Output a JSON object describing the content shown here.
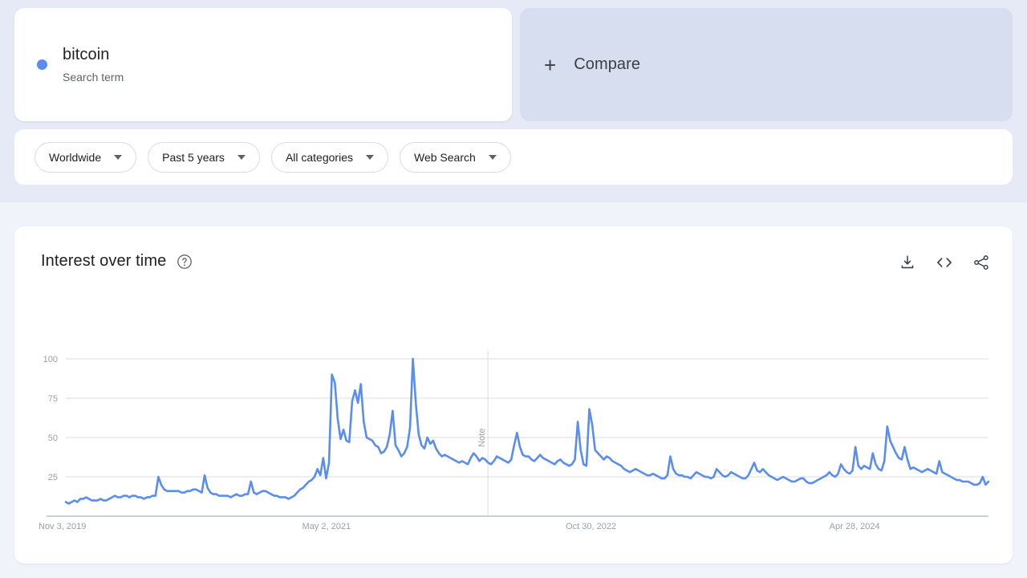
{
  "colors": {
    "series_line": "#5a8df0",
    "page_bg_top": "#e6eaf6",
    "page_bg": "#f0f3fa",
    "card_bg": "#ffffff",
    "compare_bg": "#d6deef",
    "grid": "#dadce0",
    "axis_text": "#9aa0a6",
    "text_primary": "#202124",
    "text_secondary": "#5f6368"
  },
  "search_term": {
    "label": "bitcoin",
    "type_label": "Search term",
    "dot_icon": "series-dot-icon"
  },
  "compare": {
    "label": "Compare",
    "plus_icon": "plus-icon"
  },
  "filters": [
    {
      "label": "Worldwide",
      "icon": "chevron-down-icon"
    },
    {
      "label": "Past 5 years",
      "icon": "chevron-down-icon"
    },
    {
      "label": "All categories",
      "icon": "chevron-down-icon"
    },
    {
      "label": "Web Search",
      "icon": "chevron-down-icon"
    }
  ],
  "chart_panel": {
    "title": "Interest over time",
    "help_icon": "help-circle-icon",
    "actions": [
      {
        "name": "download-icon",
        "label": "Download"
      },
      {
        "name": "embed-code-icon",
        "label": "Embed"
      },
      {
        "name": "share-icon",
        "label": "Share"
      }
    ]
  },
  "chart_data": {
    "type": "line",
    "title": "Interest over time",
    "xlabel": "",
    "ylabel": "",
    "ylim": [
      0,
      100
    ],
    "grid": true,
    "legend_position": "none",
    "y_ticks": [
      100,
      75,
      50,
      25
    ],
    "x_tick_labels": [
      "Nov 3, 2019",
      "May 2, 2021",
      "Oct 30, 2022",
      "Apr 28, 2024"
    ],
    "x_tick_positions": [
      0,
      0.2857,
      0.5714,
      0.8571
    ],
    "annotations": [
      {
        "label": "Note",
        "x_fraction": 0.4575,
        "orientation": "vertical"
      }
    ],
    "series": [
      {
        "name": "bitcoin",
        "color": "#5a8df0",
        "values": [
          9,
          8,
          9,
          10,
          9,
          11,
          11,
          12,
          11,
          10,
          10,
          10,
          11,
          10,
          10,
          11,
          12,
          13,
          12,
          12,
          13,
          13,
          12,
          13,
          13,
          12,
          12,
          11,
          12,
          12,
          13,
          13,
          25,
          20,
          17,
          16,
          16,
          16,
          16,
          16,
          15,
          15,
          16,
          16,
          17,
          17,
          16,
          15,
          26,
          18,
          15,
          14,
          14,
          13,
          13,
          13,
          13,
          12,
          13,
          14,
          13,
          13,
          14,
          14,
          22,
          15,
          14,
          15,
          16,
          16,
          15,
          14,
          13,
          13,
          12,
          12,
          12,
          11,
          12,
          13,
          15,
          17,
          18,
          20,
          22,
          23,
          25,
          30,
          26,
          37,
          24,
          34,
          90,
          85,
          62,
          49,
          55,
          48,
          47,
          73,
          80,
          72,
          84,
          60,
          50,
          49,
          48,
          45,
          44,
          40,
          41,
          44,
          52,
          67,
          45,
          42,
          38,
          40,
          44,
          56,
          100,
          72,
          52,
          45,
          43,
          50,
          46,
          48,
          43,
          40,
          38,
          39,
          38,
          37,
          36,
          35,
          34,
          35,
          34,
          33,
          37,
          40,
          38,
          35,
          37,
          36,
          34,
          33,
          35,
          38,
          37,
          36,
          35,
          34,
          36,
          45,
          53,
          44,
          39,
          38,
          38,
          36,
          35,
          37,
          39,
          37,
          36,
          35,
          34,
          33,
          35,
          36,
          34,
          33,
          32,
          33,
          36,
          60,
          42,
          33,
          32,
          68,
          58,
          42,
          40,
          38,
          36,
          38,
          37,
          35,
          34,
          33,
          32,
          30,
          29,
          28,
          29,
          30,
          29,
          28,
          27,
          26,
          26,
          27,
          26,
          25,
          24,
          24,
          26,
          38,
          30,
          27,
          26,
          26,
          25,
          25,
          24,
          26,
          28,
          27,
          26,
          25,
          25,
          24,
          25,
          30,
          28,
          26,
          25,
          26,
          28,
          27,
          26,
          25,
          24,
          24,
          26,
          30,
          34,
          29,
          28,
          30,
          28,
          26,
          25,
          24,
          23,
          24,
          25,
          24,
          23,
          22,
          22,
          23,
          24,
          24,
          22,
          21,
          21,
          22,
          23,
          24,
          25,
          26,
          28,
          26,
          25,
          27,
          33,
          30,
          28,
          27,
          29,
          44,
          32,
          30,
          32,
          31,
          30,
          40,
          33,
          30,
          29,
          35,
          57,
          48,
          44,
          40,
          37,
          36,
          44,
          36,
          30,
          31,
          30,
          29,
          28,
          29,
          30,
          29,
          28,
          27,
          35,
          28,
          27,
          26,
          25,
          24,
          23,
          23,
          22,
          22,
          22,
          21,
          20,
          20,
          21,
          25,
          20,
          22
        ]
      }
    ]
  }
}
